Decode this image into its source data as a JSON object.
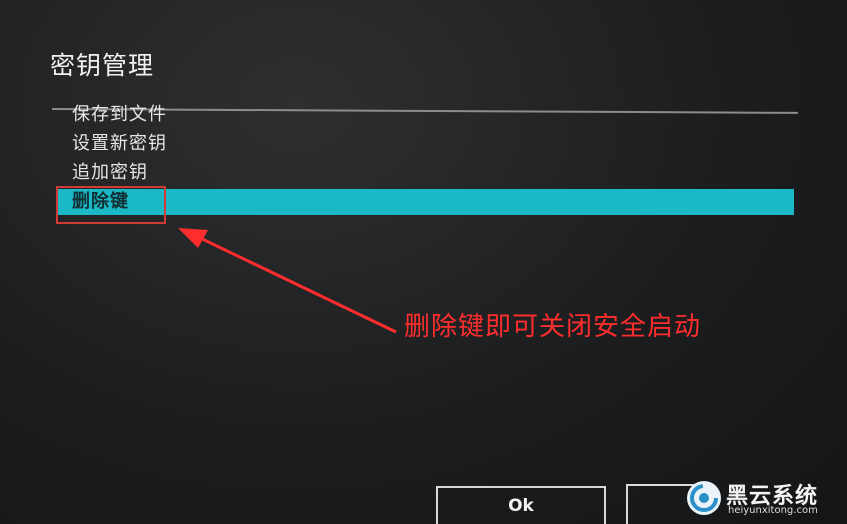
{
  "dialog": {
    "title": "密钥管理",
    "menu_items": [
      {
        "label": "保存到文件",
        "selected": false
      },
      {
        "label": "设置新密钥",
        "selected": false
      },
      {
        "label": "追加密钥",
        "selected": false
      },
      {
        "label": "删除键",
        "selected": true
      }
    ],
    "ok_label": "Ok"
  },
  "annotation": {
    "text": "删除键即可关闭安全启动",
    "color": "#ff2d2d"
  },
  "watermark": {
    "name": "黑云系统",
    "domain": "heiyunxitong.com",
    "logo_icon": "swirl-logo-icon"
  },
  "colors": {
    "selection": "#1bb8c6",
    "background": "#1c1d1f",
    "highlight_box": "#d23a35"
  }
}
